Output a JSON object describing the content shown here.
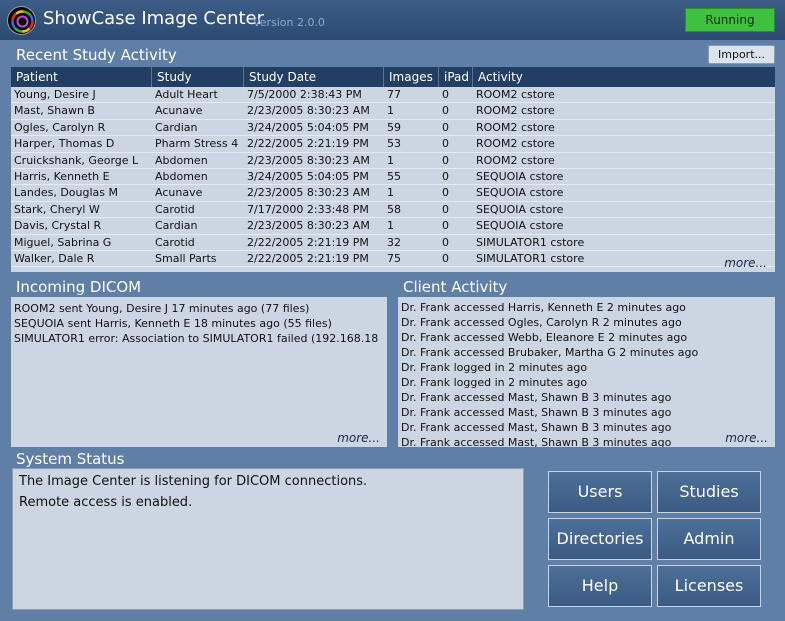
{
  "header": {
    "title": "ShowCase Image Center",
    "version": "Version 2.0.0",
    "status": "Running",
    "status_color": "#3ec23e"
  },
  "recent": {
    "title": "Recent Study Activity",
    "import_label": "Import...",
    "columns": [
      "Patient",
      "Study",
      "Study Date",
      "Images",
      "iPad",
      "Activity"
    ],
    "rows": [
      [
        "Young, Desire J",
        "Adult Heart",
        "7/5/2000 2:38:43 PM",
        "77",
        "0",
        "ROOM2 cstore"
      ],
      [
        "Mast, Shawn B",
        "Acunave",
        "2/23/2005 8:30:23 AM",
        "1",
        "0",
        "ROOM2 cstore"
      ],
      [
        "Ogles, Carolyn R",
        "Cardian",
        "3/24/2005 5:04:05 PM",
        "59",
        "0",
        "ROOM2 cstore"
      ],
      [
        "Harper, Thomas D",
        "Pharm Stress 4",
        "2/22/2005 2:21:19 PM",
        "53",
        "0",
        "ROOM2 cstore"
      ],
      [
        "Cruickshank, George L",
        "Abdomen",
        "2/23/2005 8:30:23 AM",
        "1",
        "0",
        "ROOM2 cstore"
      ],
      [
        "Harris, Kenneth E",
        "Abdomen",
        "3/24/2005 5:04:05 PM",
        "55",
        "0",
        "SEQUOIA cstore"
      ],
      [
        "Landes, Douglas M",
        "Acunave",
        "2/23/2005 8:30:23 AM",
        "1",
        "0",
        "SEQUOIA cstore"
      ],
      [
        "Stark, Cheryl W",
        "Carotid",
        "7/17/2000 2:33:48 PM",
        "58",
        "0",
        "SEQUOIA cstore"
      ],
      [
        "Davis, Crystal R",
        "Cardian",
        "2/23/2005 8:30:23 AM",
        "1",
        "0",
        "SEQUOIA cstore"
      ],
      [
        "Miguel, Sabrina G",
        "Carotid",
        "2/22/2005 2:21:19 PM",
        "32",
        "0",
        "SIMULATOR1 cstore"
      ],
      [
        "Walker, Dale R",
        "Small Parts",
        "2/22/2005 2:21:19 PM",
        "75",
        "0",
        "SIMULATOR1 cstore"
      ]
    ],
    "more_label": "more..."
  },
  "incoming": {
    "title": "Incoming DICOM",
    "lines": [
      "ROOM2 sent Young, Desire J 17 minutes ago (77 files)",
      "SEQUOIA sent Harris, Kenneth E 18 minutes ago (55 files)",
      "SIMULATOR1 error: Association to SIMULATOR1 failed (192.168.18"
    ],
    "more_label": "more..."
  },
  "client": {
    "title": "Client Activity",
    "lines": [
      "Dr. Frank accessed Harris, Kenneth E 2 minutes ago",
      "Dr. Frank accessed Ogles, Carolyn R 2 minutes ago",
      "Dr. Frank accessed Webb, Eleanore E 2 minutes ago",
      "Dr. Frank accessed Brubaker, Martha G 2 minutes ago",
      "Dr. Frank logged in 2 minutes ago",
      "Dr. Frank logged in 2 minutes ago",
      "Dr. Frank accessed Mast, Shawn B 3 minutes ago",
      "Dr. Frank accessed Mast, Shawn B 3 minutes ago",
      "Dr. Frank accessed Mast, Shawn B 3 minutes ago",
      "Dr. Frank accessed Mast, Shawn B 3 minutes ago"
    ],
    "more_label": "more..."
  },
  "system": {
    "title": "System Status",
    "lines": [
      "The Image Center is listening for DICOM connections.",
      "Remote access is enabled."
    ]
  },
  "buttons": {
    "users": "Users",
    "studies": "Studies",
    "directories": "Directories",
    "admin": "Admin",
    "help": "Help",
    "licenses": "Licenses"
  }
}
